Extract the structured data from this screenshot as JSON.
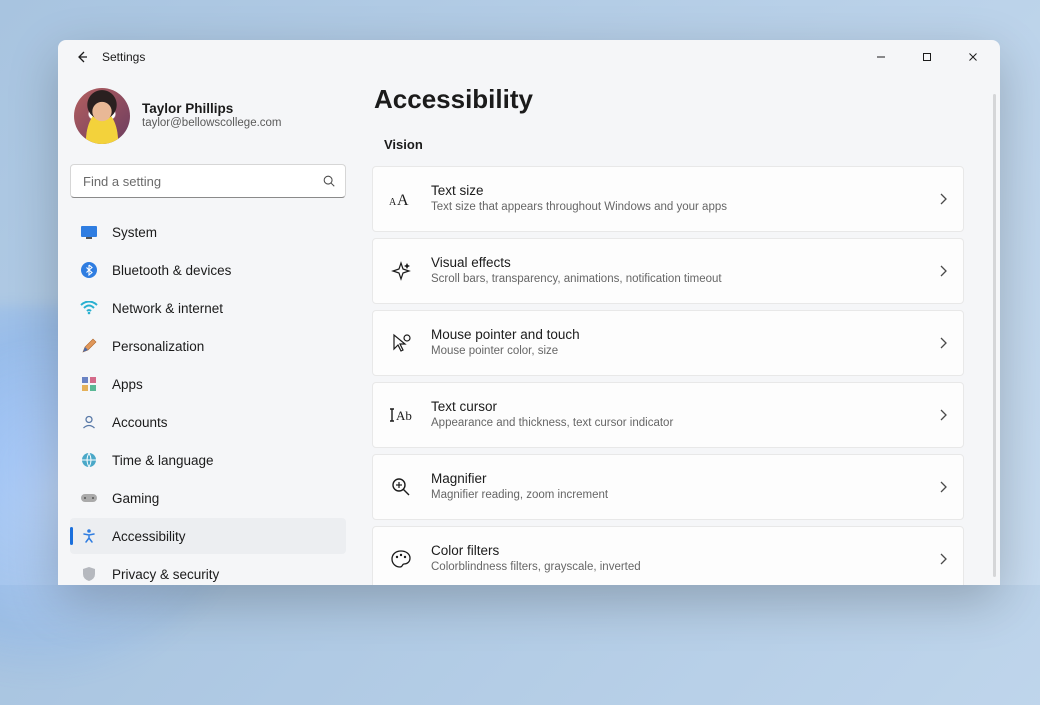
{
  "app": {
    "title": "Settings"
  },
  "profile": {
    "name": "Taylor Phillips",
    "email": "taylor@bellowscollege.com"
  },
  "search": {
    "placeholder": "Find a setting"
  },
  "sidebar": {
    "items": [
      {
        "label": "System"
      },
      {
        "label": "Bluetooth & devices"
      },
      {
        "label": "Network & internet"
      },
      {
        "label": "Personalization"
      },
      {
        "label": "Apps"
      },
      {
        "label": "Accounts"
      },
      {
        "label": "Time & language"
      },
      {
        "label": "Gaming"
      },
      {
        "label": "Accessibility"
      },
      {
        "label": "Privacy & security"
      }
    ],
    "selected_index": 8
  },
  "page": {
    "title": "Accessibility",
    "section": "Vision",
    "cards": [
      {
        "title": "Text size",
        "desc": "Text size that appears throughout Windows and your apps"
      },
      {
        "title": "Visual effects",
        "desc": "Scroll bars, transparency, animations, notification timeout"
      },
      {
        "title": "Mouse pointer and touch",
        "desc": "Mouse pointer color, size"
      },
      {
        "title": "Text cursor",
        "desc": "Appearance and thickness, text cursor indicator"
      },
      {
        "title": "Magnifier",
        "desc": "Magnifier reading, zoom increment"
      },
      {
        "title": "Color filters",
        "desc": "Colorblindness filters, grayscale, inverted"
      }
    ]
  },
  "colors": {
    "accent": "#1a6fdc"
  }
}
